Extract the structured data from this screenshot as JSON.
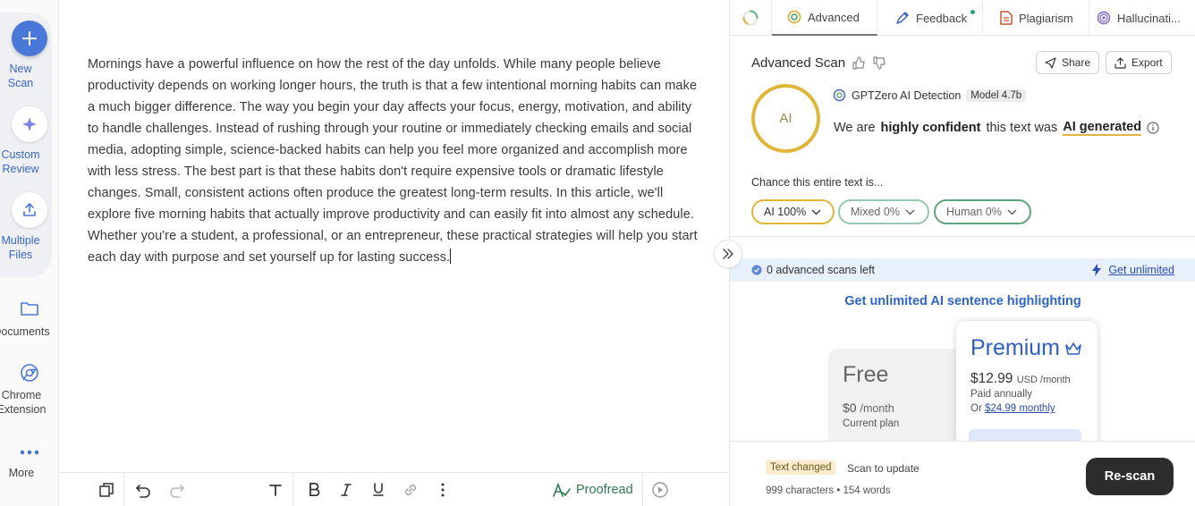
{
  "sidebar": {
    "new_scan": "New\nScan",
    "custom_review": "Custom\nReview",
    "multiple_files": "Multiple\nFiles",
    "documents": "Documents",
    "chrome_extension": "Chrome\nExtension",
    "more": "More"
  },
  "editor": {
    "text": "Mornings have a powerful influence on how the rest of the day unfolds. While many people believe productivity depends on working longer hours, the truth is that a few intentional morning habits can make a much bigger difference. The way you begin your day affects your focus, energy, motivation, and ability to handle challenges. Instead of rushing through your routine or immediately checking emails and social media, adopting simple, science-backed habits can help you feel more organized and accomplish more with less stress. The best part is that these habits don't require expensive tools or dramatic lifestyle changes. Small, consistent actions often produce the greatest long-term results. In this article, we'll explore five morning habits that actually improve productivity and can easily fit into almost any schedule. Whether you're a student, a professional, or an entrepreneur, these practical strategies will help you start each day with purpose and set yourself up for lasting success."
  },
  "toolbar": {
    "proofread_label": "Proofread"
  },
  "panel": {
    "tabs": [
      {
        "label": "Advanced",
        "icon": "advanced-icon"
      },
      {
        "label": "Feedback",
        "icon": "feedback-icon"
      },
      {
        "label": "Plagiarism",
        "icon": "plagiarism-icon"
      },
      {
        "label": "Hallucinati...",
        "icon": "hallucination-icon"
      }
    ],
    "scan_title": "Advanced Scan",
    "share_label": "Share",
    "export_label": "Export",
    "ai_badge": "AI",
    "detector_name": "GPTZero AI Detection",
    "model_badge": "Model 4.7b",
    "verdict": {
      "prefix": "We are",
      "strong": "highly confident",
      "middle": "this text was",
      "result": "AI generated"
    },
    "chance_label": "Chance this entire text is...",
    "chips": {
      "ai": "AI 100%",
      "mixed": "Mixed 0%",
      "human": "Human 0%"
    },
    "scans_left": "0 advanced scans left",
    "get_unlimited": "Get unlimited",
    "headline": "Get unlimited AI sentence highlighting",
    "free_plan": {
      "name": "Free",
      "price": "$0",
      "period": "/month",
      "current": "Current plan"
    },
    "premium_plan": {
      "name": "Premium",
      "price": "$12.99",
      "currency": "USD /month",
      "annual": "Paid annually",
      "monthly_prefix": "Or",
      "monthly_link": "$24.99 monthly"
    },
    "footer": {
      "changed_badge": "Text changed",
      "scan_to_update": "Scan to update",
      "counts": "999 characters • 154 words",
      "rescan_label": "Re-scan"
    }
  },
  "colors": {
    "accent_blue": "#4a78d8",
    "ai_yellow": "#dfb53a",
    "human_green": "#5fa27b",
    "link_blue": "#2f65c6",
    "rescan_bg": "#2c2c2c"
  }
}
